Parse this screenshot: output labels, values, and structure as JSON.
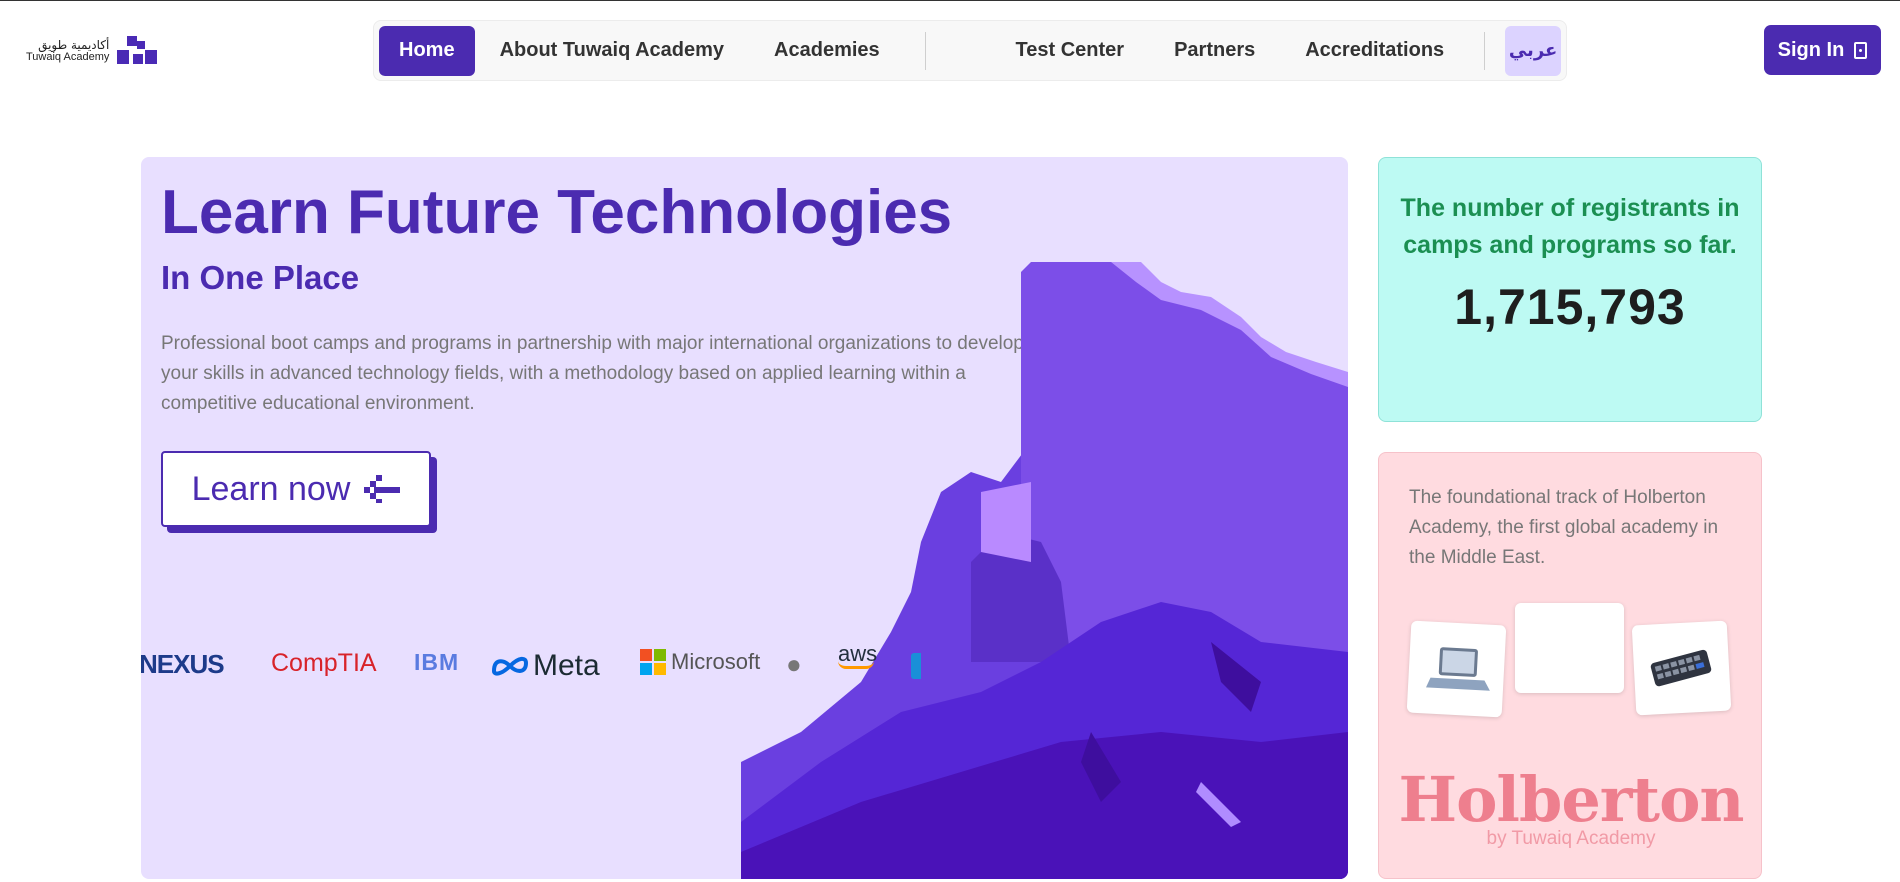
{
  "header": {
    "logo": {
      "arabic": "أكاديمية طويق",
      "english": "Tuwaiq Academy"
    },
    "nav": [
      {
        "label": "Home",
        "active": true
      },
      {
        "label": "About Tuwaiq Academy"
      },
      {
        "label": "Academies"
      },
      {
        "label": "Test Center"
      },
      {
        "label": "Partners"
      },
      {
        "label": "Accreditations"
      }
    ],
    "language_label": "عربي",
    "sign_in_label": "Sign In"
  },
  "hero": {
    "title": "Learn Future Technologies",
    "subtitle": "In One Place",
    "description": "Professional boot camps and programs in partnership with major international organizations to develop your skills in advanced technology fields, with a methodology based on applied learning within a competitive educational environment.",
    "cta_label": "Learn now",
    "partners": [
      "NEXUS",
      "CompTIA",
      "IBM",
      "Meta",
      "Microsoft",
      "aws"
    ]
  },
  "stats": {
    "label": "The number of registrants in camps and programs so far.",
    "value": "1,715,793"
  },
  "holberton": {
    "description": "The foundational track of Holberton Academy, the first global academy in the Middle East.",
    "brand": "Holberton",
    "brand_sub": "by Tuwaiq Academy"
  },
  "colors": {
    "brand_purple": "#4b2bb0",
    "hero_bg": "#e8dfff",
    "stats_bg": "#bdfaf3",
    "stats_text": "#1b8f52",
    "holberton_bg": "#ffdbe0",
    "holberton_brand": "#ee7f8e"
  }
}
